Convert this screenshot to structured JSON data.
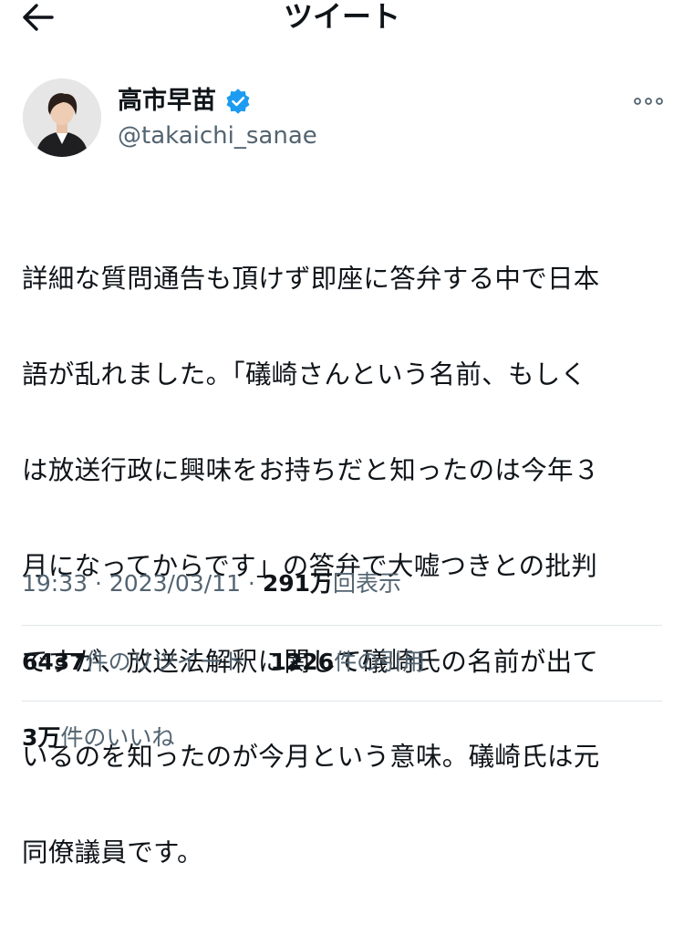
{
  "header": {
    "title": "ツイート",
    "back_icon": "arrow-left-icon"
  },
  "author": {
    "name": "高市早苗",
    "handle": "@takaichi_sanae",
    "verified_icon": "verified-badge-icon",
    "verified_color": "#1d9bf0",
    "more_icon": "more-horizontal-icon"
  },
  "tweet": {
    "lines": [
      "詳細な質問通告も頂けず即座に答弁する中で日本",
      "語が乱れました。「礒崎さんという名前、もしく",
      "は放送行政に興味をお持ちだと知ったのは今年３",
      "月になってからです」の答弁で大嘘つきとの批判",
      "ですが、放送法解釈に関して礒崎氏の名前が出て",
      "いるのを知ったのが今月という意味。礒崎氏は元",
      "同僚議員です。"
    ]
  },
  "meta": {
    "time": "19:33",
    "date": "2023/03/11",
    "sep": " · ",
    "views_count": "291万",
    "views_label": "回表示"
  },
  "stats": {
    "retweets_count": "6437",
    "retweets_label": "件のリツイート",
    "quotes_count": "1226",
    "quotes_label": "件の引用",
    "likes_count": "3万",
    "likes_label": "件のいいね"
  },
  "colors": {
    "text": "#0f1419",
    "secondary": "#536471",
    "divider": "#e1e6ea"
  }
}
